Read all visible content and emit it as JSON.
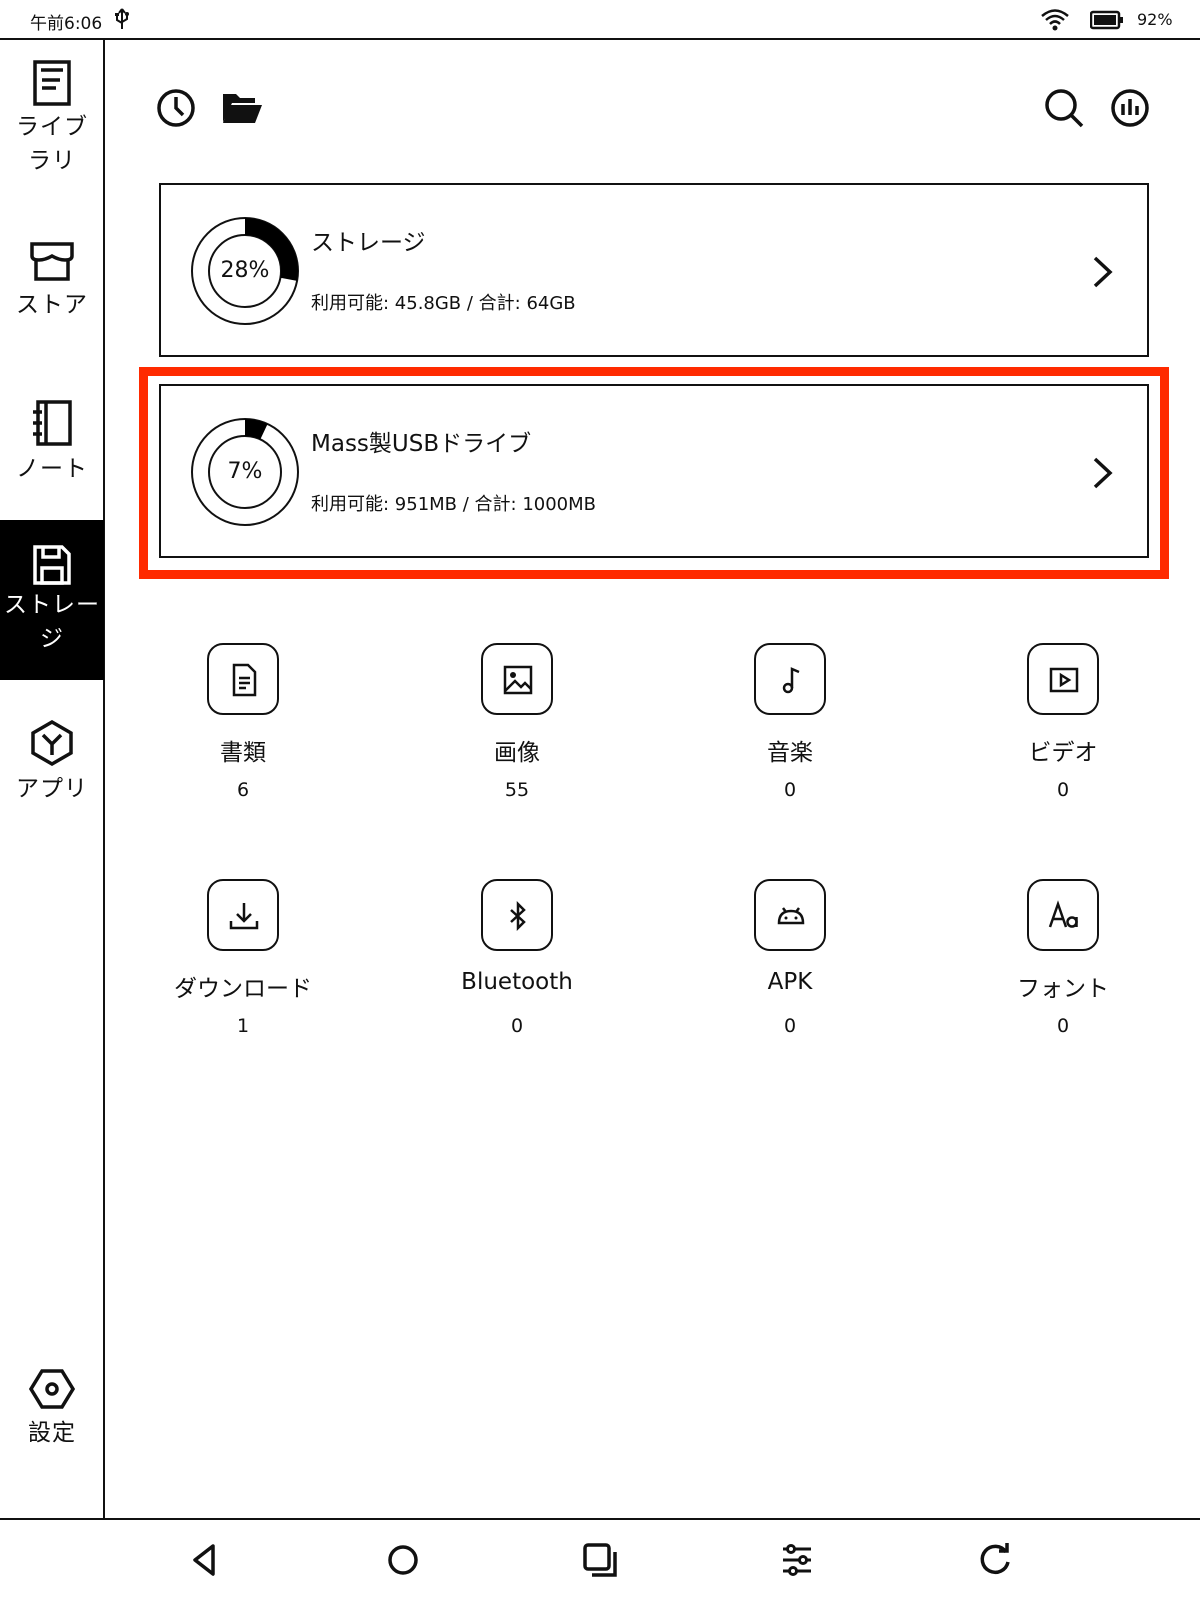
{
  "status_bar": {
    "time": "午前6:06",
    "battery": "92%"
  },
  "sidebar": {
    "items": [
      {
        "label": "ライブラリ",
        "icon": "library-icon"
      },
      {
        "label": "ストア",
        "icon": "store-icon"
      },
      {
        "label": "ノート",
        "icon": "notebook-icon"
      },
      {
        "label": "ストレージ",
        "icon": "floppy-disk-icon",
        "active": true
      },
      {
        "label": "アプリ",
        "icon": "apps-icon"
      }
    ],
    "settings_label": "設定"
  },
  "toolbar": {
    "left_icons": [
      "history-icon",
      "folder-icon"
    ],
    "right_icons": [
      "search-icon",
      "statistics-icon"
    ]
  },
  "storage_cards": [
    {
      "title": "ストレージ",
      "percent": "28%",
      "used_fraction": 0.28,
      "detail": "利用可能: 45.8GB / 合計: 64GB"
    },
    {
      "title": "Mass製USBドライブ",
      "percent": "7%",
      "used_fraction": 0.07,
      "detail": "利用可能: 951MB / 合計: 1000MB",
      "highlighted": true
    }
  ],
  "categories": [
    {
      "label": "書類",
      "count": "6",
      "icon": "document-icon"
    },
    {
      "label": "画像",
      "count": "55",
      "icon": "image-icon"
    },
    {
      "label": "音楽",
      "count": "0",
      "icon": "music-note-icon"
    },
    {
      "label": "ビデオ",
      "count": "0",
      "icon": "video-icon"
    },
    {
      "label": "ダウンロード",
      "count": "1",
      "icon": "download-icon"
    },
    {
      "label": "Bluetooth",
      "count": "0",
      "icon": "bluetooth-icon"
    },
    {
      "label": "APK",
      "count": "0",
      "icon": "android-icon"
    },
    {
      "label": "フォント",
      "count": "0",
      "icon": "font-icon"
    }
  ],
  "nav_bar": [
    "back-icon",
    "home-icon",
    "recents-icon",
    "adjust-icon",
    "refresh-icon"
  ],
  "colors": {
    "highlight": "#ff2a00",
    "ink": "#111111"
  }
}
